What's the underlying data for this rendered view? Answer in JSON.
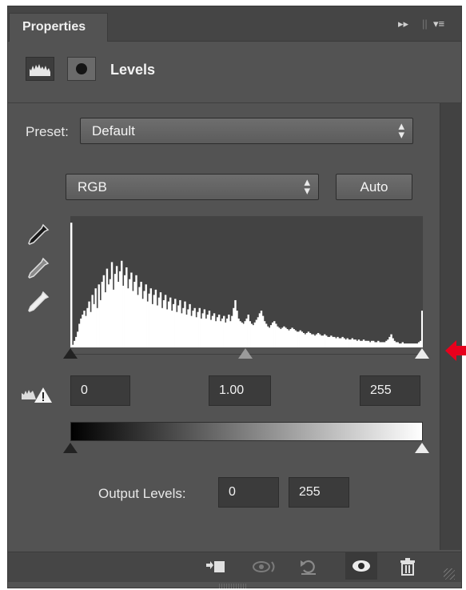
{
  "panel": {
    "tab_label": "Properties",
    "title": "Levels",
    "header_icons": [
      "levels-adjustment-icon",
      "mask-icon"
    ],
    "tab_controls": [
      "collapse-icon",
      "panel-menu-icon"
    ]
  },
  "preset": {
    "label": "Preset:",
    "value": "Default"
  },
  "channel": {
    "value": "RGB",
    "auto_label": "Auto"
  },
  "eyedroppers": [
    "black-point-eyedropper-icon",
    "gray-point-eyedropper-icon",
    "white-point-eyedropper-icon"
  ],
  "input_levels": {
    "shadows": "0",
    "midtones": "1.00",
    "highlights": "255"
  },
  "output_levels": {
    "label": "Output Levels:",
    "low": "0",
    "high": "255"
  },
  "histogram": {
    "color": "#ffffff",
    "background": "#434343",
    "bins": [
      0.95,
      0.02,
      0.05,
      0.08,
      0.12,
      0.18,
      0.22,
      0.25,
      0.28,
      0.24,
      0.3,
      0.35,
      0.27,
      0.4,
      0.33,
      0.45,
      0.3,
      0.48,
      0.36,
      0.5,
      0.55,
      0.42,
      0.6,
      0.48,
      0.52,
      0.65,
      0.44,
      0.56,
      0.62,
      0.5,
      0.58,
      0.66,
      0.47,
      0.55,
      0.61,
      0.45,
      0.52,
      0.57,
      0.43,
      0.5,
      0.55,
      0.4,
      0.46,
      0.5,
      0.37,
      0.43,
      0.48,
      0.35,
      0.41,
      0.45,
      0.33,
      0.4,
      0.44,
      0.32,
      0.38,
      0.42,
      0.3,
      0.36,
      0.4,
      0.29,
      0.35,
      0.38,
      0.28,
      0.33,
      0.37,
      0.27,
      0.32,
      0.36,
      0.26,
      0.3,
      0.35,
      0.25,
      0.29,
      0.33,
      0.24,
      0.28,
      0.3,
      0.23,
      0.27,
      0.3,
      0.22,
      0.26,
      0.29,
      0.22,
      0.25,
      0.28,
      0.21,
      0.24,
      0.26,
      0.2,
      0.23,
      0.25,
      0.2,
      0.22,
      0.24,
      0.19,
      0.22,
      0.25,
      0.2,
      0.24,
      0.3,
      0.36,
      0.28,
      0.22,
      0.2,
      0.19,
      0.18,
      0.2,
      0.22,
      0.25,
      0.2,
      0.18,
      0.17,
      0.19,
      0.21,
      0.23,
      0.26,
      0.28,
      0.24,
      0.2,
      0.18,
      0.16,
      0.15,
      0.17,
      0.19,
      0.2,
      0.18,
      0.16,
      0.15,
      0.14,
      0.15,
      0.16,
      0.15,
      0.14,
      0.13,
      0.14,
      0.15,
      0.14,
      0.13,
      0.12,
      0.12,
      0.13,
      0.12,
      0.11,
      0.1,
      0.11,
      0.12,
      0.11,
      0.1,
      0.1,
      0.09,
      0.1,
      0.11,
      0.1,
      0.09,
      0.09,
      0.1,
      0.09,
      0.08,
      0.08,
      0.09,
      0.08,
      0.08,
      0.07,
      0.08,
      0.07,
      0.07,
      0.08,
      0.07,
      0.06,
      0.07,
      0.06,
      0.06,
      0.07,
      0.06,
      0.06,
      0.05,
      0.06,
      0.05,
      0.05,
      0.06,
      0.05,
      0.05,
      0.05,
      0.04,
      0.05,
      0.05,
      0.04,
      0.04,
      0.05,
      0.04,
      0.04,
      0.04,
      0.04,
      0.05,
      0.06,
      0.08,
      0.1,
      0.07,
      0.05,
      0.04,
      0.04,
      0.03,
      0.03,
      0.04,
      0.03,
      0.03,
      0.03,
      0.03,
      0.03,
      0.03,
      0.03,
      0.03,
      0.03,
      0.04,
      0.05,
      0.28
    ]
  },
  "footer_icons": {
    "clip": "clip-to-layer-icon",
    "view_previous": "view-previous-state-icon",
    "reset": "reset-icon",
    "visibility": "visibility-eye-icon",
    "delete": "trash-icon"
  },
  "annotation_color": "#e8001c"
}
